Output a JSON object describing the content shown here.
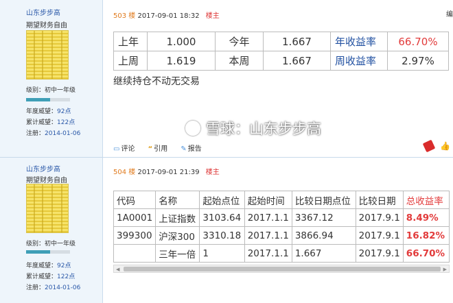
{
  "posts": [
    {
      "user": {
        "name": "山东步步高",
        "signature": "期望财务自由",
        "level": "级别：初中一年级",
        "level_progress": 0.55,
        "annual_label": "年度威望：",
        "annual_value": "92点",
        "total_label": "累计威望：",
        "total_value": "122点",
        "register_label": "注册：",
        "register_value": "2014-01-06"
      },
      "floor": "503 楼",
      "time": "2017-09-01 18:32",
      "owner_tag": "楼主",
      "edit_label": "编",
      "table": [
        [
          "上年",
          "1.000",
          "今年",
          "1.667",
          "年收益率",
          "66.70%"
        ],
        [
          "上周",
          "1.619",
          "本周",
          "1.667",
          "周收益率",
          "2.97%"
        ]
      ],
      "note": "继续持仓不动无交易",
      "actions": {
        "comment": "评论",
        "quote": "引用",
        "report": "报告"
      }
    },
    {
      "user": {
        "name": "山东步步高",
        "signature": "期望财务自由",
        "level": "级别：初中一年级",
        "level_progress": 0.55,
        "annual_label": "年度威望：",
        "annual_value": "92点",
        "total_label": "累计威望：",
        "total_value": "122点",
        "register_label": "注册：",
        "register_value": "2014-01-06"
      },
      "floor": "504 楼",
      "time": "2017-09-01 21:39",
      "owner_tag": "楼主",
      "table_headers": [
        "代码",
        "名称",
        "起始点位",
        "起始时间",
        "比较日期点位",
        "比较日期",
        "总收益率"
      ],
      "table_rows": [
        [
          "1A0001",
          "上证指数",
          "3103.64",
          "2017.1.1",
          "3367.12",
          "2017.9.1",
          "8.49%"
        ],
        [
          "399300",
          "沪深300",
          "3310.18",
          "2017.1.1",
          "3866.94",
          "2017.9.1",
          "16.82%"
        ],
        [
          "",
          "三年一倍",
          "1",
          "2017.1.1",
          "1.667",
          "2017.9.1",
          "66.70%"
        ]
      ]
    }
  ],
  "watermark": "雪球：山东步步高",
  "colors": {
    "sidebar_bg": "#eef5fb",
    "link_blue": "#2a58a8",
    "red": "#e23b3b",
    "floor_orange": "#e07a1c"
  }
}
